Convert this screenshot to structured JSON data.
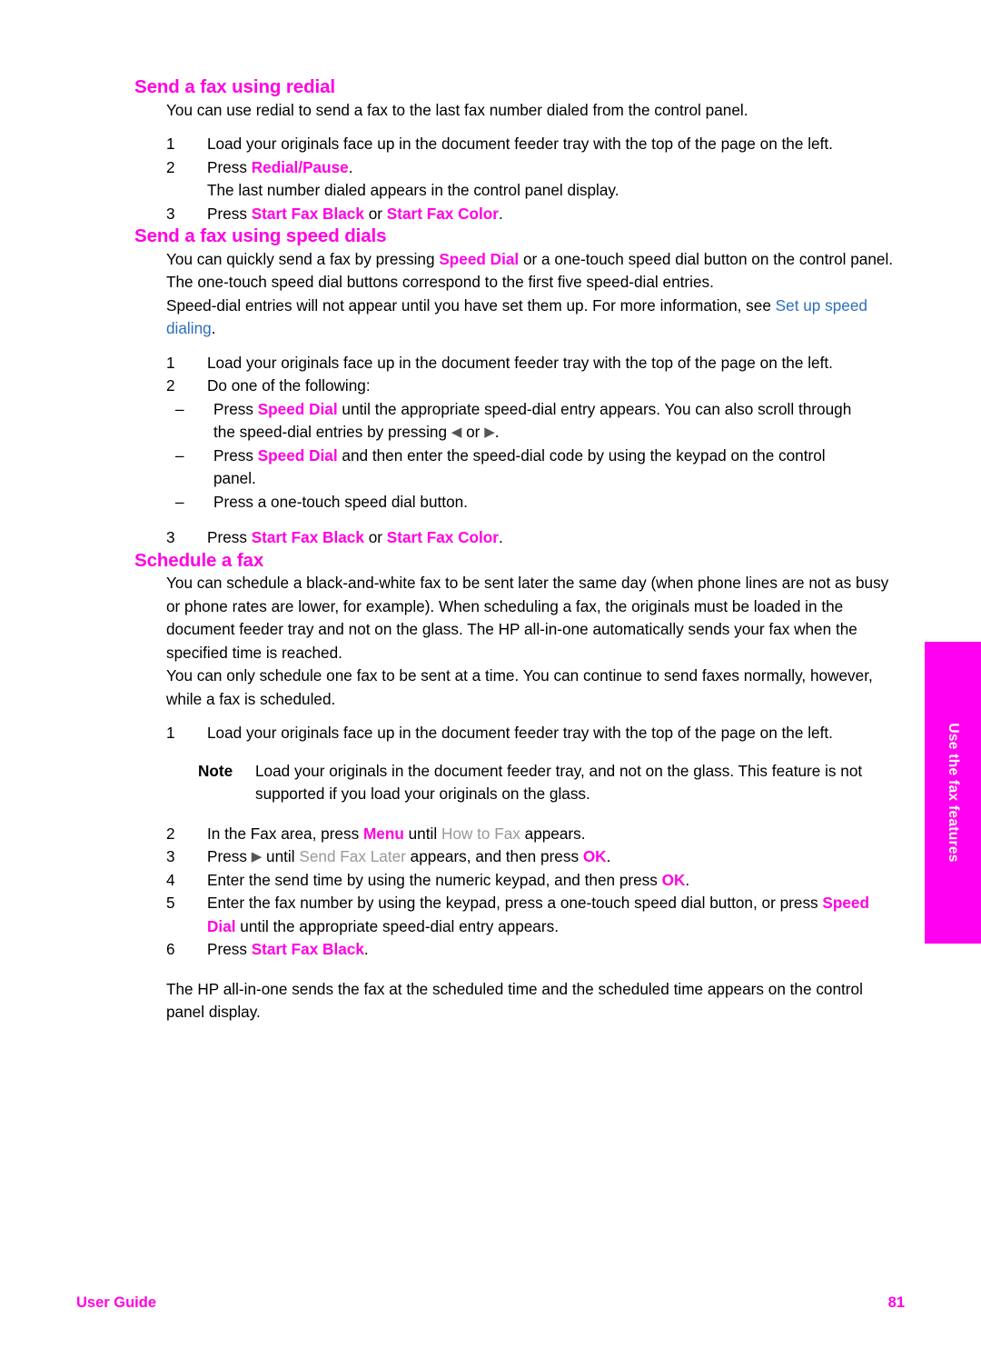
{
  "side_tab": {
    "label": "Use the fax features",
    "color": "#ff00f0"
  },
  "colors": {
    "key_magenta": "#ff00e4",
    "display_gray": "#999999",
    "link_blue": "#2c6fbb"
  },
  "sections": {
    "redial": {
      "heading": "Send a fax using redial",
      "intro": "You can use redial to send a fax to the last fax number dialed from the control panel.",
      "steps": [
        {
          "num": "1",
          "text": "Load your originals face up in the document feeder tray with the top of the page on the left."
        },
        {
          "num": "2",
          "lead": "Press ",
          "key": "Redial/Pause",
          "tail": ".",
          "result": "The last number dialed appears in the control panel display."
        },
        {
          "num": "3",
          "lead": "Press ",
          "key1": "Start Fax Black",
          "mid": " or ",
          "key2": "Start Fax Color",
          "tail": "."
        }
      ]
    },
    "speed_dials": {
      "heading": "Send a fax using speed dials",
      "para1_a": "You can quickly send a fax by pressing ",
      "para1_key": "Speed Dial",
      "para1_b": " or a one-touch speed dial button on the control panel. The one-touch speed dial buttons correspond to the first five speed-dial entries.",
      "para2_a": "Speed-dial entries will not appear until you have set them up. For more information, see ",
      "para2_link": "Set up speed dialing",
      "para2_b": ".",
      "steps": [
        {
          "num": "1",
          "text": "Load your originals face up in the document feeder tray with the top of the page on the left."
        },
        {
          "num": "2",
          "text": "Do one of the following:"
        }
      ],
      "sub_items": [
        {
          "dash": "–",
          "lead": "Press ",
          "key": "Speed Dial",
          "mid": " until the appropriate speed-dial entry appears. You can also scroll through the speed-dial entries by pressing ",
          "icon_left": "◀",
          "or": " or ",
          "icon_right": "▶",
          "tail": "."
        },
        {
          "dash": "–",
          "lead": "Press ",
          "key": "Speed Dial",
          "mid": " and then enter the speed-dial code by using the keypad on the control panel."
        },
        {
          "dash": "–",
          "lead": "Press a one-touch speed dial button."
        }
      ],
      "final_step": {
        "num": "3",
        "lead": "Press ",
        "key1": "Start Fax Black",
        "mid": " or ",
        "key2": "Start Fax Color",
        "tail": "."
      }
    },
    "schedule": {
      "heading": "Schedule a fax",
      "para1": "You can schedule a black-and-white fax to be sent later the same day (when phone lines are not as busy or phone rates are lower, for example). When scheduling a fax, the originals must be loaded in the document feeder tray and not on the glass. The HP all-in-one automatically sends your fax when the specified time is reached.",
      "para2": "You can only schedule one fax to be sent at a time. You can continue to send faxes normally, however, while a fax is scheduled.",
      "step1": {
        "num": "1",
        "text": "Load your originals face up in the document feeder tray with the top of the page on the left."
      },
      "note": {
        "label": "Note",
        "text": "Load your originals in the document feeder tray, and not on the glass. This feature is not supported if you load your originals on the glass."
      },
      "steps": [
        {
          "num": "2",
          "lead": "In the Fax area, press ",
          "key": "Menu",
          "mid": " until ",
          "display": "How to Fax",
          "tail": " appears."
        },
        {
          "num": "3",
          "lead": "Press ",
          "icon": "▶",
          "mid": " until ",
          "display": "Send Fax Later",
          "mid2": " appears, and then press ",
          "key": "OK",
          "tail": "."
        },
        {
          "num": "4",
          "lead": "Enter the send time by using the numeric keypad, and then press ",
          "key": "OK",
          "tail": "."
        },
        {
          "num": "5",
          "lead": "Enter the fax number by using the keypad, press a one-touch speed dial button, or press ",
          "key": "Speed Dial",
          "tail": " until the appropriate speed-dial entry appears."
        },
        {
          "num": "6",
          "lead": "Press ",
          "key": "Start Fax Black",
          "tail": "."
        }
      ],
      "closing": "The HP all-in-one sends the fax at the scheduled time and the scheduled time appears on the control panel display."
    }
  },
  "footer": {
    "left": "User Guide",
    "page_number": "81"
  }
}
